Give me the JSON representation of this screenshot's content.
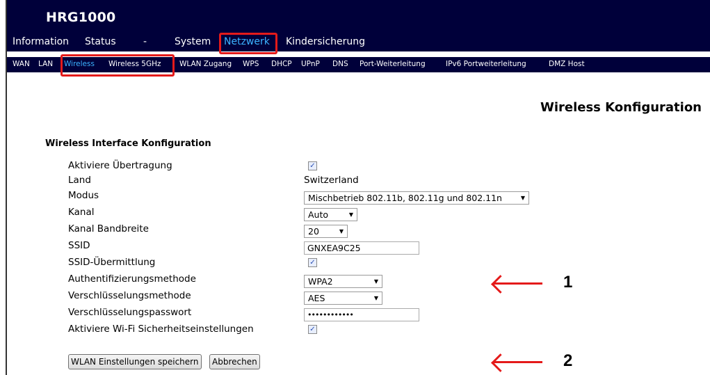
{
  "brand": "HRG1000",
  "main_nav": [
    "Information",
    "Status",
    "-",
    "System",
    "Netzwerk",
    "Kindersicherung"
  ],
  "sub_nav": [
    "WAN",
    "LAN",
    "Wireless",
    "Wireless 5GHz",
    "WLAN Zugang",
    "WPS",
    "DHCP",
    "UPnP",
    "DNS",
    "Port-Weiterleitung",
    "IPv6 Portweiterleitung",
    "DMZ Host"
  ],
  "page_title": "Wireless Konfiguration",
  "section_title": "Wireless Interface Konfiguration",
  "fields": {
    "enable": {
      "label": "Aktiviere Übertragung",
      "checked": true
    },
    "country": {
      "label": "Land",
      "value": "Switzerland"
    },
    "mode": {
      "label": "Modus",
      "value": "Mischbetrieb 802.11b, 802.11g und 802.11n"
    },
    "channel": {
      "label": "Kanal",
      "value": "Auto"
    },
    "bandwidth": {
      "label": "Kanal Bandbreite",
      "value": "20"
    },
    "ssid": {
      "label": "SSID",
      "value": "GNXEA9C25"
    },
    "ssid_broadcast": {
      "label": "SSID-Übermittlung",
      "checked": true
    },
    "auth": {
      "label": "Authentifizierungsmethode",
      "value": "WPA2"
    },
    "encryption": {
      "label": "Verschlüsselungsmethode",
      "value": "AES"
    },
    "password": {
      "label": "Verschlüsselungspasswort",
      "value": "••••••••••••"
    },
    "wifi_security": {
      "label": "Aktiviere Wi-Fi Sicherheitseinstellungen",
      "checked": true
    }
  },
  "buttons": {
    "save": "WLAN Einstellungen speichern",
    "cancel": "Abbrechen"
  },
  "annotations": [
    "1",
    "2"
  ],
  "colors": {
    "nav_bg": "#00003a",
    "active_link": "#3cb4ff",
    "highlight": "#e41a1a"
  }
}
